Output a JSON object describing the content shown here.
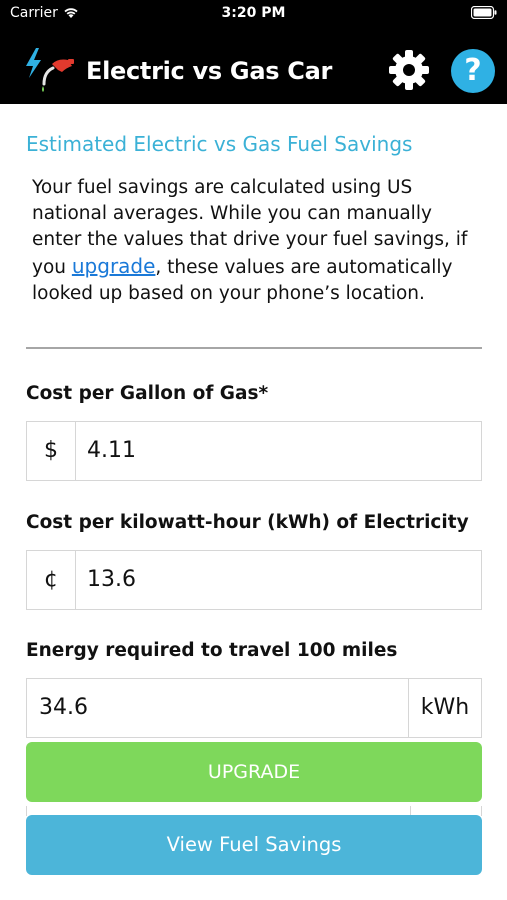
{
  "status_bar": {
    "carrier": "Carrier",
    "time": "3:20 PM",
    "wifi_icon": "wifi-icon",
    "battery_icon": "battery-icon"
  },
  "nav": {
    "title": "Electric vs Gas Car",
    "logo_icon": "plug-and-gas-nozzle-icon",
    "settings_icon": "gear-icon",
    "help_label": "?",
    "help_color": "#2fb1e4"
  },
  "content": {
    "heading": "Estimated Electric vs Gas Fuel Savings",
    "heading_color": "#3bb1d6",
    "intro_before": "Your fuel savings are calculated using US national averages. While you can manually enter the values that drive your fuel savings, if you ",
    "intro_link": "upgrade",
    "intro_after": ", these values are automatically looked up based on your phone’s location."
  },
  "fields": {
    "gas": {
      "label": "Cost per Gallon of Gas*",
      "prefix": "$",
      "value": "4.11"
    },
    "electricity": {
      "label": "Cost per kilowatt-hour (kWh) of Electricity",
      "prefix": "¢",
      "value": "13.6"
    },
    "energy": {
      "label": "Energy required to travel 100 miles",
      "value": "34.6",
      "suffix": "kWh"
    }
  },
  "buttons": {
    "upgrade_label": "UPGRADE",
    "upgrade_color": "#7ed85b",
    "view_savings_label": "View Fuel Savings",
    "view_savings_color": "#4cb5d9"
  }
}
